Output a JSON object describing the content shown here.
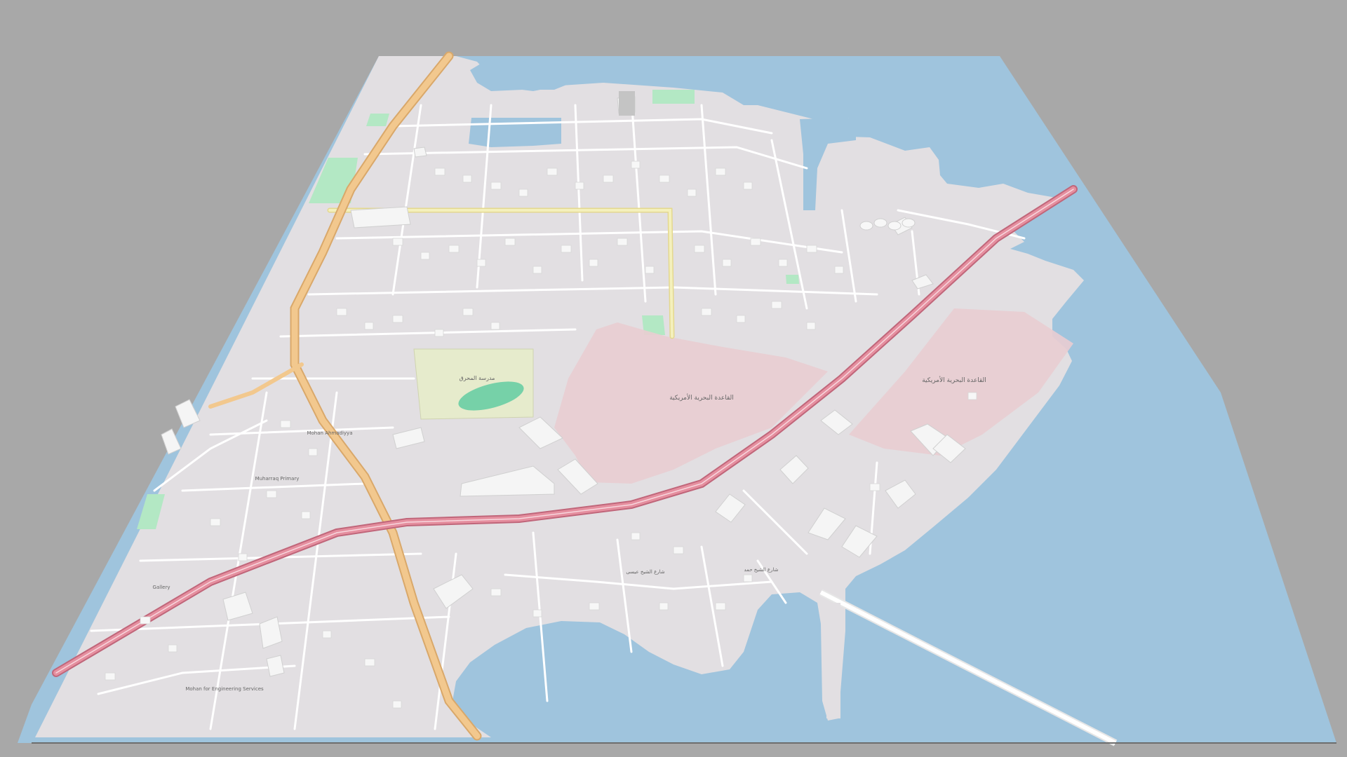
{
  "scene": {
    "view": "3d-perspective-map",
    "background_color": "#a8a8a8",
    "land_color": "#e2dfe2",
    "water_color": "#9fc4dd",
    "park_color": "#b3e8c4",
    "track_color": "#76d1a8",
    "sports_field_color": "#e6ebcc",
    "military_area_color": "#e9cdd2",
    "motorway_color": "#e58f9f",
    "trunk_road_color": "#f2c88e",
    "secondary_road_color": "#f4f0bc",
    "building_color": "#f5f5f5"
  },
  "labels": {
    "sports_ground": "مدرسة المحرق",
    "naval_base": "القاعدة البحرية الأمريكية",
    "naval_base_2": "القاعدة البحرية الأمريكية",
    "museum": "Mohan Ahmadiyya",
    "school_area": "Muharraq Primary",
    "gallery": "Gallery",
    "engineering": "Mohan for Engineering Services",
    "bridge_road": "شارع الشيخ حمد",
    "corniche": "شارع الشيخ عيسى"
  }
}
